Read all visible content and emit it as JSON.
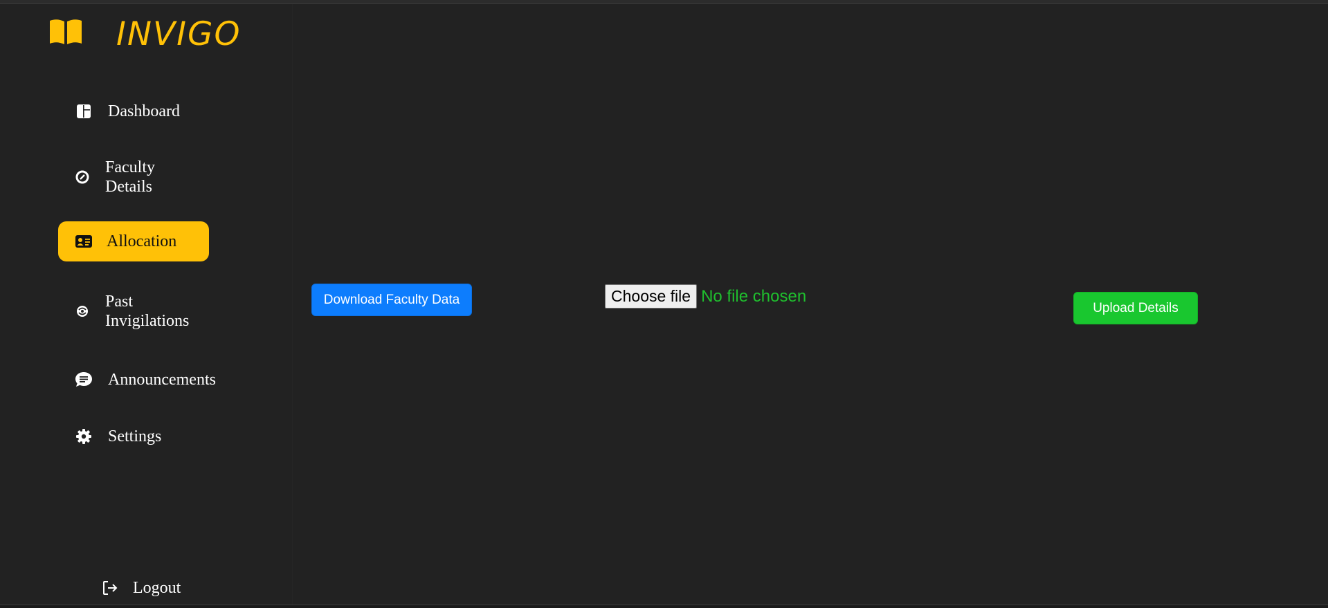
{
  "app": {
    "title": "INVIGO",
    "logo_icon": "open-book-icon",
    "accent_color": "#ffc107"
  },
  "sidebar": {
    "items": [
      {
        "label": "Dashboard",
        "icon": "dashboard-grid-icon",
        "active": false
      },
      {
        "label": "Faculty Details",
        "icon": "gauge-icon",
        "active": false
      },
      {
        "label": "Allocation",
        "icon": "id-card-icon",
        "active": true
      },
      {
        "label": "Past Invigilations",
        "icon": "swirl-icon",
        "active": false
      },
      {
        "label": "Announcements",
        "icon": "chat-bubble-icon",
        "active": false
      },
      {
        "label": "Settings",
        "icon": "gear-icon",
        "active": false
      }
    ],
    "logout_label": "Logout",
    "logout_icon": "logout-arrow-icon"
  },
  "main": {
    "download_button": "Download Faculty Data",
    "download_color": "#0d7dfd",
    "file_input": {
      "button_label": "Choose file",
      "status_text": "No file chosen",
      "status_color": "#1fbf2e"
    },
    "upload_button": "Upload Details",
    "upload_color": "#19c72f"
  }
}
